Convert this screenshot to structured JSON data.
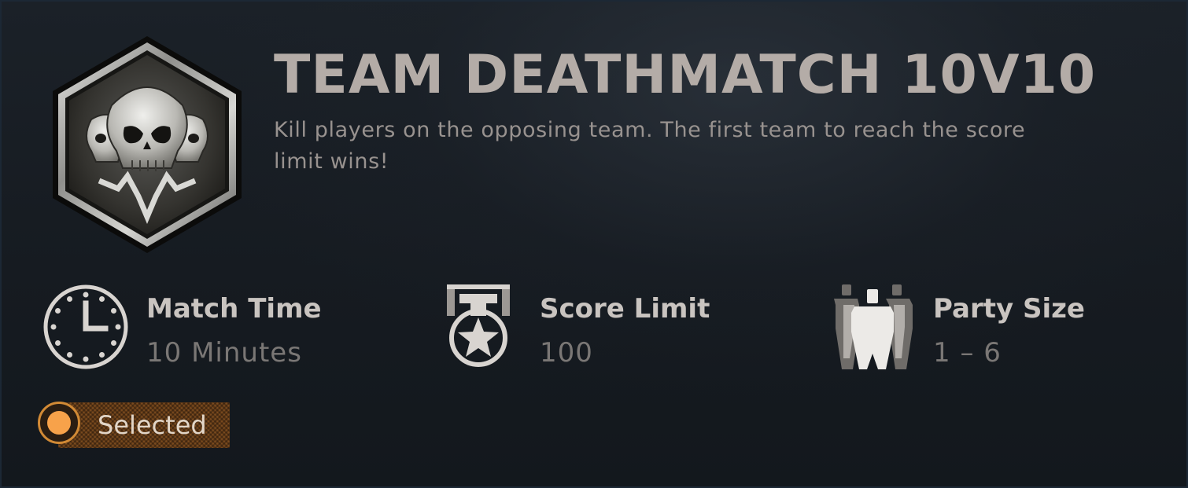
{
  "mode": {
    "title": "TEAM DEATHMATCH 10V10",
    "description": "Kill players on the opposing team. The first team to reach the score limit wins!",
    "emblem_icon": "skulls-hexagon-emblem-icon"
  },
  "stats": [
    {
      "label": "Match Time",
      "value": "10 Minutes",
      "icon": "clock-icon"
    },
    {
      "label": "Score Limit",
      "value": "100",
      "icon": "star-medal-icon"
    },
    {
      "label": "Party Size",
      "value": "1 – 6",
      "icon": "party-group-icon"
    }
  ],
  "selection": {
    "label": "Selected",
    "is_selected": true,
    "accent_color": "#f7a24a"
  },
  "colors": {
    "background": "#181d23",
    "title": "#b4aca7",
    "description": "#98928f",
    "stat_label": "#c9c4c0",
    "stat_value": "#7a7775",
    "badge": "#7a4a1e"
  }
}
